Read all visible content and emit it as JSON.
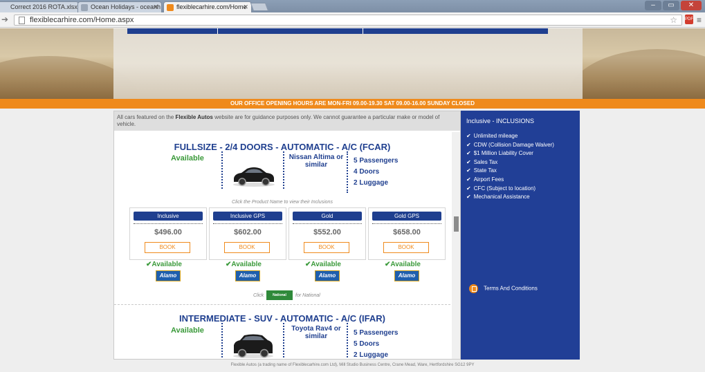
{
  "browser": {
    "tabs": [
      {
        "label": "Correct 2016 ROTA.xlsx"
      },
      {
        "label": "Ocean Holidays - oceanh"
      },
      {
        "label": "flexiblecarhire.com/Home"
      }
    ],
    "url": "flexiblecarhire.com/Home.aspx"
  },
  "banner": {
    "opening_hours": "OUR OFFICE OPENING HOURS ARE MON-FRI 09.00-19.30 SAT 09.00-16.00 SUNDAY CLOSED"
  },
  "disclaimer": {
    "before": "All cars featured on the ",
    "brand": "Flexible Autos",
    "after": " website are for guidance purposes only. We cannot guarantee a particular make or model of vehicle."
  },
  "cars": [
    {
      "title": "FULLSIZE - 2/4 DOORS - AUTOMATIC - A/C (FCAR)",
      "availability": "Available",
      "model": "Nissan Altima or similar",
      "specs": [
        "5 Passengers",
        "4 Doors",
        "2 Luggage"
      ],
      "note": "Click the Product Name to view their Inclusions",
      "rates": [
        {
          "name": "Inclusive",
          "price": "$496.00",
          "book": "BOOK",
          "availability": "Available",
          "supplier": "Alamo"
        },
        {
          "name": "Inclusive GPS",
          "price": "$602.00",
          "book": "BOOK",
          "availability": "Available",
          "supplier": "Alamo"
        },
        {
          "name": "Gold",
          "price": "$552.00",
          "book": "BOOK",
          "availability": "Available",
          "supplier": "Alamo"
        },
        {
          "name": "Gold GPS",
          "price": "$658.00",
          "book": "BOOK",
          "availability": "Available",
          "supplier": "Alamo"
        }
      ],
      "national": {
        "before": "Click",
        "logo": "National",
        "after": "for National"
      }
    },
    {
      "title": "INTERMEDIATE - SUV - AUTOMATIC - A/C (IFAR)",
      "availability": "Available",
      "model": "Toyota Rav4 or similar",
      "specs": [
        "5 Passengers",
        "5 Doors",
        "2 Luggage"
      ]
    }
  ],
  "sidebar": {
    "title": "Inclusive - INCLUSIONS",
    "inclusions": [
      "Unlimited mileage",
      "CDW (Collision Damage Waiver)",
      "$1 Million Liability Cover",
      "Sales Tax",
      "State Tax",
      "Airport Fees",
      "CFC (Subject to location)",
      "Mechanical Assistance"
    ],
    "terms": "Terms And Conditions"
  },
  "footer": "Flexible Autos (a trading name of Flexiblecarhire.com Ltd), Mill Studio Business Centre, Crane Mead, Ware, Hertfordshire SG12 9PY",
  "colors": {
    "brand_blue": "#1f3f8f",
    "accent_orange": "#ef8a1c",
    "available_green": "#3b9a3b"
  }
}
